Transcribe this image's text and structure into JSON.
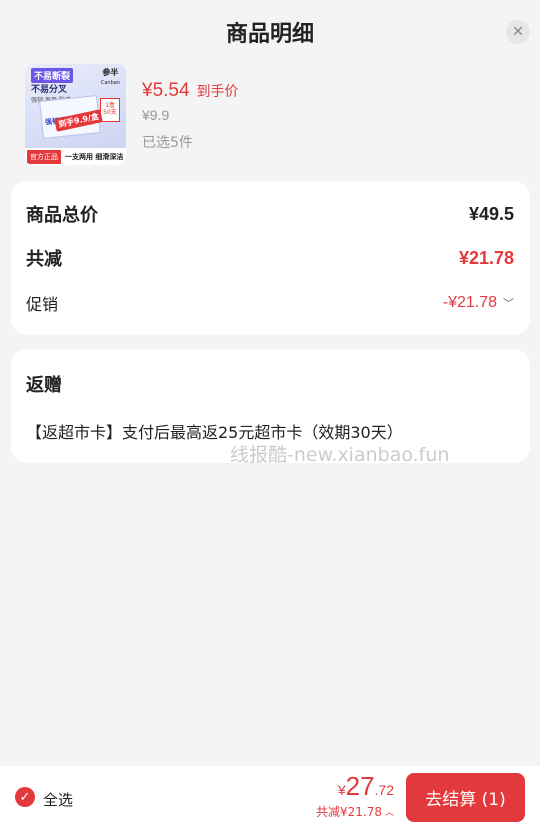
{
  "header": {
    "title": "商品明细",
    "close_icon": "close-icon"
  },
  "product": {
    "image": {
      "tag1": "不易断裂",
      "tag2": "不易分叉",
      "tag3": "强韧 再用 防缠",
      "brand": "参半",
      "brand_en": "Canban",
      "box_label": "强韧顺滑",
      "pkg": "1盒 50支",
      "promo": "到手9.9/盒",
      "official": "官方正品",
      "slogan": "一支两用 细滑深洁"
    },
    "price": "¥5.54",
    "price_tag": "到手价",
    "original_price": "¥9.9",
    "selected": "已选5件"
  },
  "summary": {
    "total_label": "商品总价",
    "total_value": "¥49.5",
    "reduce_label": "共减",
    "reduce_value": "¥21.78",
    "promo_label": "促销",
    "promo_value": "-¥21.78"
  },
  "gift": {
    "title": "返赠",
    "text": "【返超市卡】支付后最高返25元超市卡（效期30天）"
  },
  "watermark": "线报酷-new.xianbao.fun",
  "bottom": {
    "select_all": "全选",
    "total_symbol": "¥",
    "total_int": "27",
    "total_dec": ".72",
    "reduce_text": "共减¥21.78",
    "checkout": "去结算 (1)"
  },
  "colors": {
    "accent": "#e4393c",
    "background": "#f4f4f4"
  }
}
